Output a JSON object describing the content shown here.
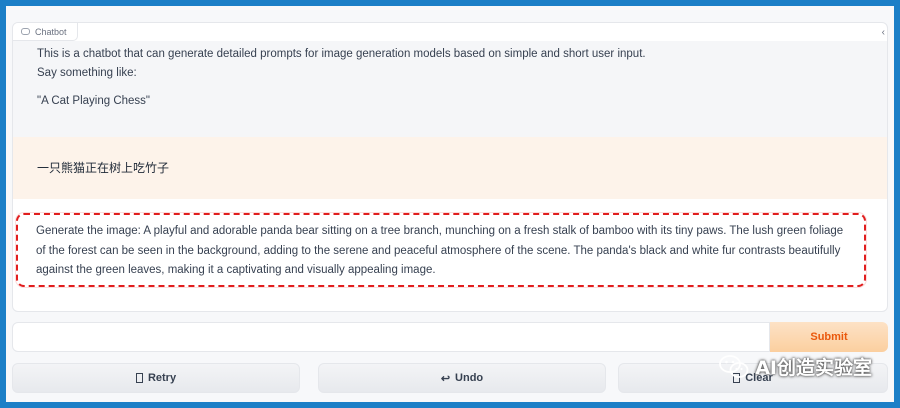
{
  "chatbot": {
    "label": "Chatbot",
    "intro_line1": "This is a chatbot that can generate detailed prompts for image generation models based on simple and short user input.",
    "intro_line2": "Say something like:",
    "intro_example": "\"A Cat Playing Chess\"",
    "user_message": "一只熊猫正在树上吃竹子",
    "bot_reply": "Generate the image: A playful and adorable panda bear sitting on a tree branch, munching on a fresh stalk of bamboo with its tiny paws. The lush green foliage of the forest can be seen in the background, adding to the serene and peaceful atmosphere of the scene. The panda's black and white fur contrasts beautifully against the green leaves, making it a captivating and visually appealing image."
  },
  "input": {
    "value": "",
    "placeholder": ""
  },
  "buttons": {
    "submit": "Submit",
    "retry": "Retry",
    "undo": "Undo",
    "undo_glyph": "↩",
    "clear": "Clear"
  },
  "watermark": {
    "text": "AI创造实验室"
  },
  "colors": {
    "frame_border": "#1b7fc7",
    "user_bubble": "#fdf3ea",
    "highlight_dash": "#e11d1d",
    "submit_text": "#ea580c"
  },
  "icons": {
    "chat_label": "chat-bubble-icon",
    "retry": "box-glyph-icon",
    "undo": "undo-arrow-icon",
    "clear": "box-glyph-icon",
    "watermark": "wechat-logo-icon"
  }
}
